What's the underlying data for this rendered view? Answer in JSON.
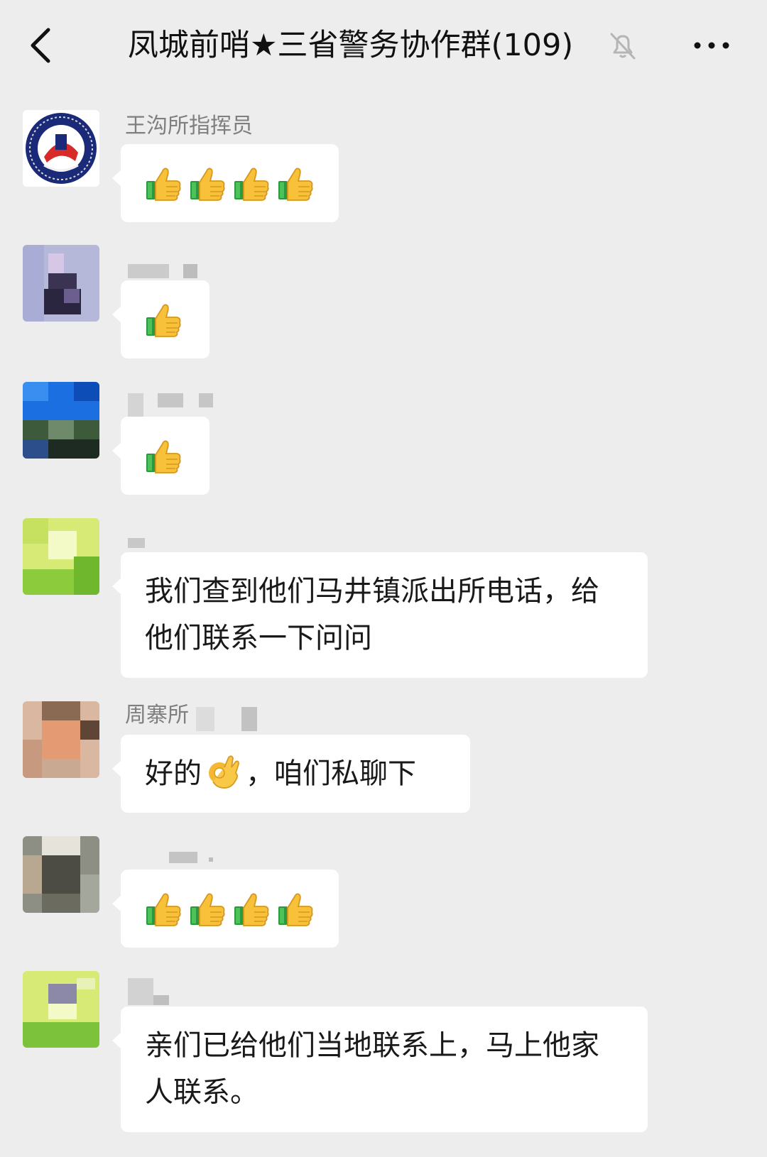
{
  "header": {
    "title": "凤城前哨★三省警务协作群(109)",
    "icons": [
      "back-arrow-icon",
      "mute-bell-icon",
      "more-dots-icon"
    ]
  },
  "messages": [
    {
      "sender": "王沟所指挥员",
      "avatar": "police-badge-avatar",
      "content": "4x thumbs-up emoji"
    },
    {
      "sender": "",
      "sender_blurred": true,
      "avatar": "blurred-avatar",
      "content": "1x thumbs-up emoji"
    },
    {
      "sender": "",
      "sender_blurred": true,
      "avatar": "blurred-avatar",
      "content": "1x thumbs-up emoji"
    },
    {
      "sender": "",
      "sender_blurred": true,
      "avatar": "blurred-avatar",
      "text": "我们查到他们马井镇派出所电话，给他们联系一下问问"
    },
    {
      "sender": "周寨所",
      "sender_partially_blurred": true,
      "avatar": "blurred-avatar",
      "text_before": "好的",
      "text_after": "，咱们私聊下",
      "emoji": "ok-hand-emoji"
    },
    {
      "sender": "",
      "sender_blurred": true,
      "avatar": "blurred-avatar",
      "content": "4x thumbs-up emoji"
    },
    {
      "sender": "",
      "sender_blurred": true,
      "avatar": "blurred-avatar",
      "text": "亲们已给他们当地联系上，马上他家人联系。"
    }
  ],
  "colors": {
    "background": "#ededed",
    "bubble": "#ffffff",
    "sender_name": "#7f7f7f",
    "text": "#191919"
  }
}
